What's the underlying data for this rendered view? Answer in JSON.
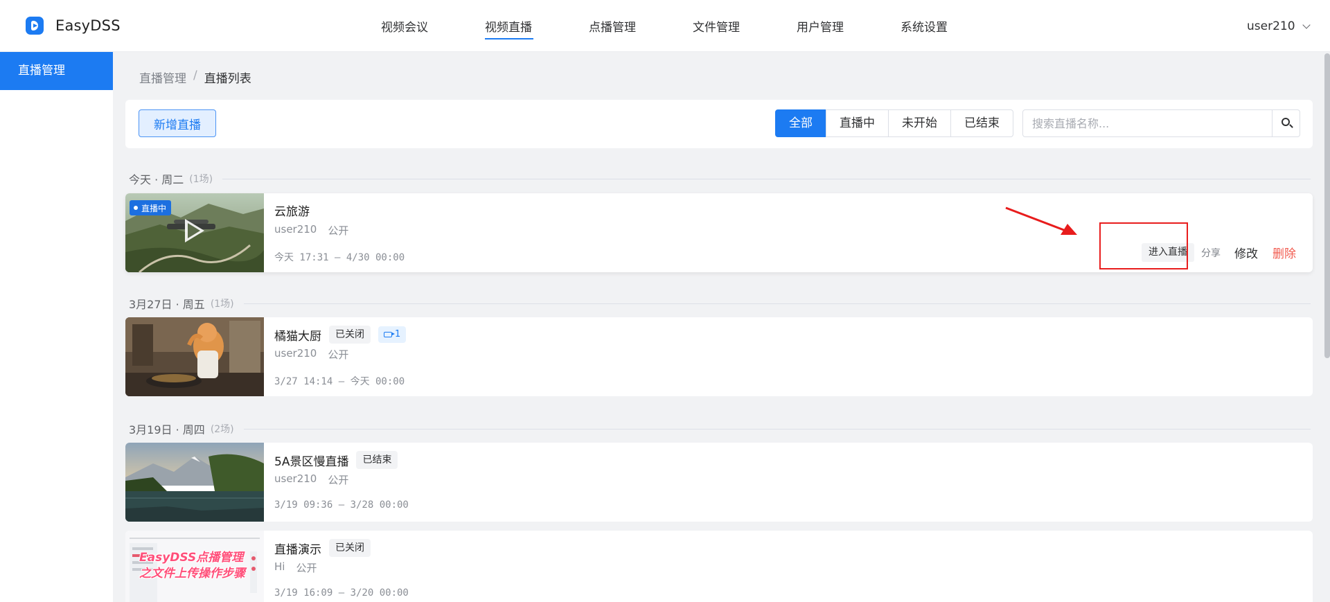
{
  "app": {
    "title": "EasyDSS"
  },
  "nav": {
    "items": [
      {
        "label": "视频会议"
      },
      {
        "label": "视频直播"
      },
      {
        "label": "点播管理"
      },
      {
        "label": "文件管理"
      },
      {
        "label": "用户管理"
      },
      {
        "label": "系统设置"
      }
    ],
    "active": "视频直播"
  },
  "user": {
    "name": "user210"
  },
  "sidebar": {
    "items": [
      {
        "label": "直播管理"
      }
    ]
  },
  "breadcrumb": {
    "parent": "直播管理",
    "separator": "/",
    "current": "直播列表"
  },
  "toolbar": {
    "add_label": "新增直播",
    "filters": [
      {
        "label": "全部"
      },
      {
        "label": "直播中"
      },
      {
        "label": "未开始"
      },
      {
        "label": "已结束"
      }
    ],
    "active_filter": "全部",
    "search_placeholder": "搜索直播名称..."
  },
  "groups": [
    {
      "date": "今天 · 周二",
      "count": "(1场)",
      "items": [
        {
          "title": "云旅游",
          "badge": "直播中",
          "owner": "user210",
          "visibility": "公开",
          "time": "今天 17:31 – 4/30 00:00",
          "actions": {
            "enter": "进入直播",
            "share": "分享",
            "edit": "修改",
            "delete": "删除"
          }
        }
      ]
    },
    {
      "date": "3月27日 · 周五",
      "count": "(1场)",
      "items": [
        {
          "title": "橘猫大厨",
          "status": "已关闭",
          "cam_count": "1",
          "owner": "user210",
          "visibility": "公开",
          "time": "3/27 14:14 – 今天 00:00"
        }
      ]
    },
    {
      "date": "3月19日 · 周四",
      "count": "(2场)",
      "items": [
        {
          "title": "5A景区慢直播",
          "status": "已结束",
          "owner": "user210",
          "visibility": "公开",
          "time": "3/19 09:36 – 3/28 00:00"
        },
        {
          "title": "直播演示",
          "status": "已关闭",
          "owner": "Hi",
          "visibility": "公开",
          "time": "3/19 16:09 – 3/20 00:00",
          "thumb_text": [
            "EasyDSS点播管理",
            "之文件上传操作步骤"
          ]
        }
      ]
    }
  ],
  "colors": {
    "accent": "#1c7bf2",
    "danger": "#f15a4e",
    "annotation": "#e81c1c"
  },
  "icons": {
    "search": "search-icon",
    "logo": "logo-icon",
    "chevron": "chevron-down-icon",
    "play": "play-icon",
    "camera": "camera-icon"
  }
}
